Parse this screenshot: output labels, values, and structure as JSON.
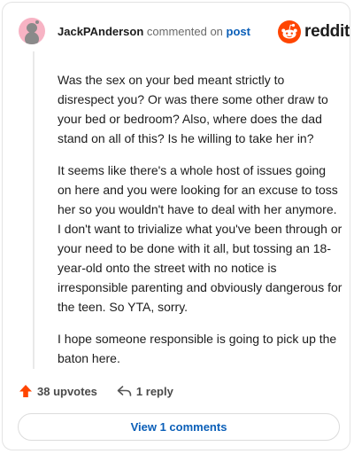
{
  "comment": {
    "author": "JackPAnderson",
    "verb": "commented on",
    "target": "post",
    "paragraphs": [
      "Was the sex on your bed meant strictly to disrespect you? Or was there some other draw to your bed or bedroom? Also, where does the dad stand on all of this? Is he willing to take her in?",
      "It seems like there's a whole host of issues going on here and you were looking for an excuse to toss her so you wouldn't have to deal with her anymore. I don't want to trivialize what you've been through or your need to be done with it all, but tossing an 18-year-old onto the street with no notice is irresponsible parenting and obviously dangerous for the teen. So YTA, sorry.",
      "I hope someone responsible is going to pick up the baton here."
    ]
  },
  "brand": {
    "name": "reddit",
    "icon": "reddit-logo-icon",
    "color": "#ff4500"
  },
  "actions": {
    "upvotes_label": "38 upvotes",
    "upvote_icon": "upvote-arrow-icon",
    "upvote_color": "#ff4500",
    "reply_label": "1 reply",
    "reply_icon": "reply-arrow-icon"
  },
  "footer": {
    "view_comments_label": "View 1 comments"
  },
  "colors": {
    "link": "#0b5fb8",
    "avatar_bg": "#f7b3c4"
  }
}
